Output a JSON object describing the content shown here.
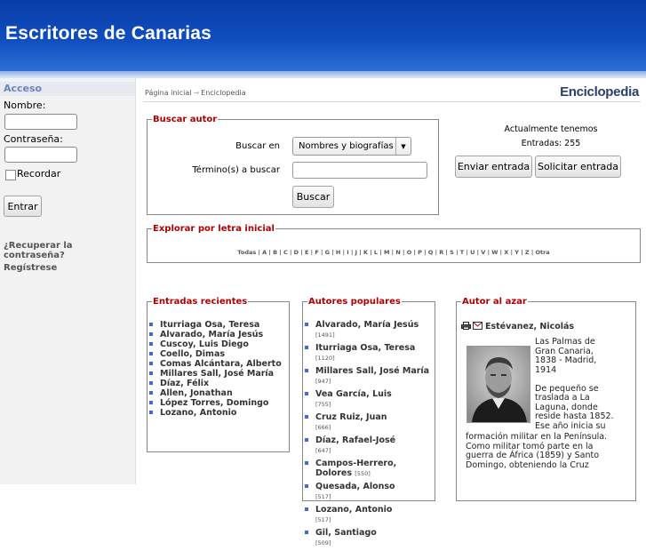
{
  "site": {
    "title": "Escritores de Canarias"
  },
  "sidebar": {
    "heading": "Acceso",
    "name_label": "Nombre:",
    "password_label": "Contraseña:",
    "remember_label": "Recordar",
    "login_button": "Entrar",
    "recover_link": "¿Recuperar la contraseña?",
    "register_link": "Regístrese"
  },
  "main": {
    "breadcrumb": {
      "home": "Página inicial",
      "arrow": "→",
      "current": "Enciclopedia"
    },
    "section_title": "Enciclopedia",
    "search": {
      "legend": "Buscar autor",
      "search_in_label": "Buscar en",
      "search_in_value": "Nombres y biografías",
      "terms_label": "Término(s) a buscar",
      "terms_value": "",
      "submit_label": "Buscar"
    },
    "stats": {
      "line1": "Actualmente tenemos",
      "line2": "Entradas: 255",
      "send_entry_button": "Enviar entrada",
      "request_entry_button": "Solicitar entrada"
    },
    "explore": {
      "legend": "Explorar por letra inicial",
      "letters": [
        "Todas",
        "A",
        "B",
        "C",
        "D",
        "E",
        "F",
        "G",
        "H",
        "I",
        "J",
        "K",
        "L",
        "M",
        "N",
        "O",
        "P",
        "Q",
        "R",
        "S",
        "T",
        "U",
        "V",
        "W",
        "X",
        "Y",
        "Z",
        "Otra"
      ]
    },
    "recent": {
      "legend": "Entradas recientes",
      "items": [
        "Iturriaga Osa, Teresa",
        "Alvarado, María Jesús",
        "Cuscoy, Luis Diego",
        "Coello, Dimas",
        "Comas Alcántara, Alberto",
        "Millares Sall, José María",
        "Díaz, Félix",
        "Allen, Jonathan",
        "López Torres, Domingo",
        "Lozano, Antonio"
      ]
    },
    "popular": {
      "legend": "Autores populares",
      "items": [
        {
          "name": "Alvarado, María Jesús",
          "count": "[1491]"
        },
        {
          "name": "Iturriaga Osa, Teresa",
          "count": "[1120]"
        },
        {
          "name": "Millares Sall, José María",
          "count": "[947]"
        },
        {
          "name": "Vea García, Luis",
          "count": "[755]"
        },
        {
          "name": "Cruz Ruiz, Juan",
          "count": "[666]"
        },
        {
          "name": "Díaz, Rafael-José",
          "count": "[647]"
        },
        {
          "name": "Campos-Herrero, Dolores",
          "count": "[550]"
        },
        {
          "name": "Quesada, Alonso",
          "count": "[517]"
        },
        {
          "name": "Lozano, Antonio",
          "count": "[517]"
        },
        {
          "name": "Gil, Santiago",
          "count": "[509]"
        }
      ]
    },
    "random": {
      "legend": "Autor al azar",
      "name": "Estévanez, Nicolás",
      "bio_side": [
        "Las Palmas de",
        "Gran Canaria,",
        "1838 - Madrid,",
        "1914",
        "",
        "De pequeño se",
        "traslada a La",
        "Laguna, donde",
        "reside hasta 1852.",
        "Ese año inicia su"
      ],
      "bio_full": [
        "formación militar en la Península.",
        "Como militar tomó parte en la",
        "guerra de África (1859) y Santo",
        "Domingo, obteniendo la Cruz"
      ]
    }
  }
}
